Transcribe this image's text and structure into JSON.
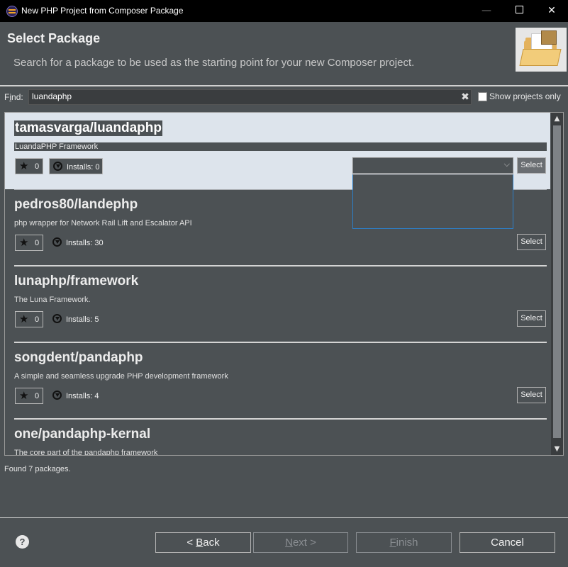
{
  "window": {
    "title": "New PHP Project from Composer Package",
    "minimize_glyph": "—",
    "close_glyph": "✕"
  },
  "header": {
    "title": "Select Package",
    "description": "Search for a package to be used as the starting point for your new Composer project."
  },
  "find": {
    "label_underlined": "i",
    "label_pre": "F",
    "label_post": "nd:",
    "value": "luandaphp",
    "clear_glyph": "✖",
    "show_projects_only_label": "Show projects only",
    "show_projects_only_checked": false
  },
  "packages": [
    {
      "name": "tamasvarga/luandaphp",
      "description": "LuandaPHP Framework",
      "stars": "0",
      "installs": "Installs: 0",
      "select_label": "Select"
    },
    {
      "name": "pedros80/landephp",
      "description": "php wrapper for Network Rail Lift and Escalator API",
      "stars": "0",
      "installs": "Installs: 30",
      "select_label": "Select"
    },
    {
      "name": "lunaphp/framework",
      "description": "The Luna Framework.",
      "stars": "0",
      "installs": "Installs: 5",
      "select_label": "Select"
    },
    {
      "name": "songdent/pandaphp",
      "description": "A simple and seamless upgrade PHP development framework",
      "stars": "0",
      "installs": "Installs: 4",
      "select_label": "Select"
    },
    {
      "name": "one/pandaphp-kernal",
      "description": "The core part of the pandaphp framework"
    }
  ],
  "status": "Found 7 packages.",
  "buttons": {
    "back_pre": "< ",
    "back_underlined": "B",
    "back_post": "ack",
    "next_underlined": "N",
    "next_post": "ext >",
    "finish_underlined": "F",
    "finish_post": "inish",
    "cancel": "Cancel"
  },
  "help_glyph": "?"
}
